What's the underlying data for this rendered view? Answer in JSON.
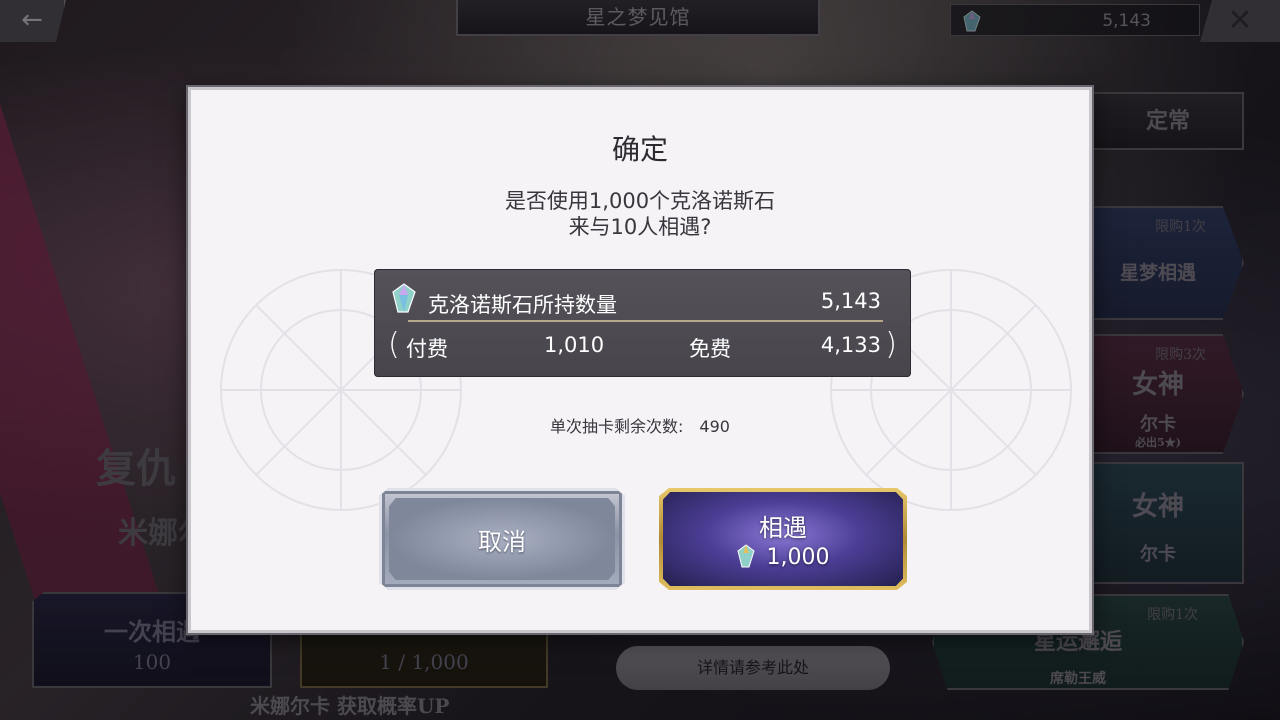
{
  "header": {
    "back_icon": "arrow-left-icon",
    "title": "星之梦见馆",
    "currency_icon": "chronos-stone-icon",
    "currency_amount": "5,143",
    "close_icon": "close-icon"
  },
  "side_menu": {
    "regular_tab": "定常",
    "item1": {
      "limit": "限购1次",
      "name": "星梦相遇"
    },
    "item2": {
      "limit": "限购3次",
      "name": "女神",
      "sub": "尔卡",
      "note": "必出5★)"
    },
    "item3": {
      "name": "女神",
      "sub": "尔卡"
    },
    "item4": {
      "limit": "限购1次",
      "name": "星运邂逅",
      "sub": "席勒王威"
    }
  },
  "bottom": {
    "single_draw_label": "一次相遇",
    "single_draw_cost": "100",
    "ten_draw_cost": "1 / 1,000",
    "detail_button": "详情请参考此处",
    "rate_up_banner": "米娜尔卡 获取概率UP"
  },
  "background_text": {
    "revenge": "复仇",
    "name": "米娜尔"
  },
  "dialog": {
    "title": "确定",
    "message_line1": "是否使用1,000个克洛诺斯石",
    "message_line2": "来与10人相遇?",
    "balance": {
      "gem_icon": "chronos-stone-icon",
      "label": "克洛诺斯石所持数量",
      "total": "5,143",
      "paren_open": "(",
      "paid_label": "付费",
      "paid_value": "1,010",
      "free_label": "免费",
      "free_value": "4,133",
      "paren_close": ")"
    },
    "remaining_label": "单次抽卡剩余次数:",
    "remaining_value": "490",
    "cancel_label": "取消",
    "confirm_label": "相遇",
    "confirm_cost": "1,000"
  },
  "colors": {
    "modal_bg": "#f5f3f6",
    "panel_bg": "#4f4c54",
    "confirm_gold": "#d4b35a",
    "confirm_purple": "#4c3e96",
    "cancel_silver": "#9aa1b2"
  }
}
